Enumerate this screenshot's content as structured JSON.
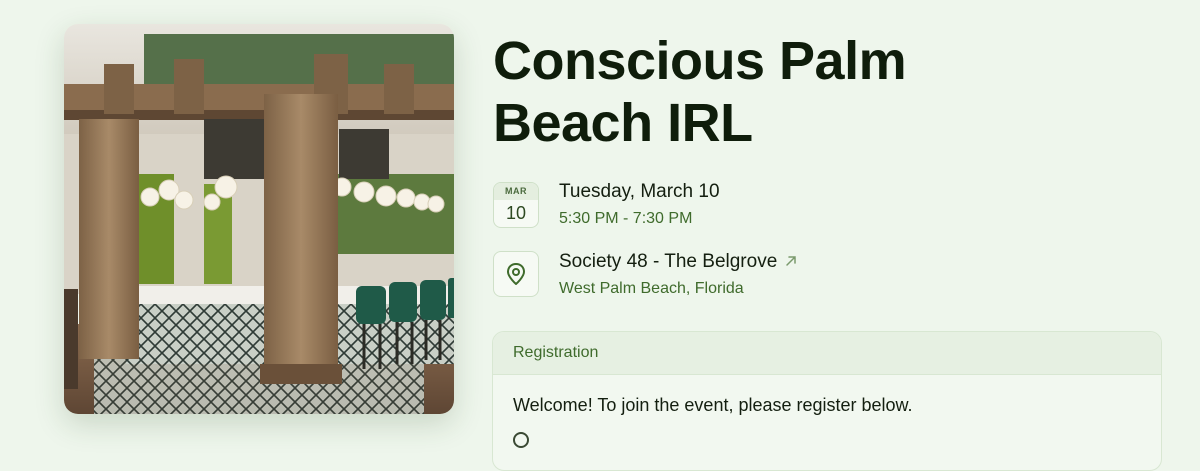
{
  "event": {
    "title_line1": "Conscious Palm",
    "title_line2": "Beach IRL",
    "cover_image": "cover-image"
  },
  "date": {
    "month": "MAR",
    "day": "10",
    "weekday_date": "Tuesday, March 10",
    "time_range": "5:30 PM - 7:30 PM"
  },
  "location": {
    "venue": "Society 48 - The Belgrove",
    "city": "West Palm Beach, Florida",
    "pin_icon": "map-pin-icon",
    "link_icon": "arrow-up-right-icon"
  },
  "registration": {
    "header": "Registration",
    "message": "Welcome! To join the event, please register below."
  },
  "colors": {
    "background": "#eef6ec",
    "accent_green": "#3f6b2c",
    "title": "#0f1d0b"
  }
}
